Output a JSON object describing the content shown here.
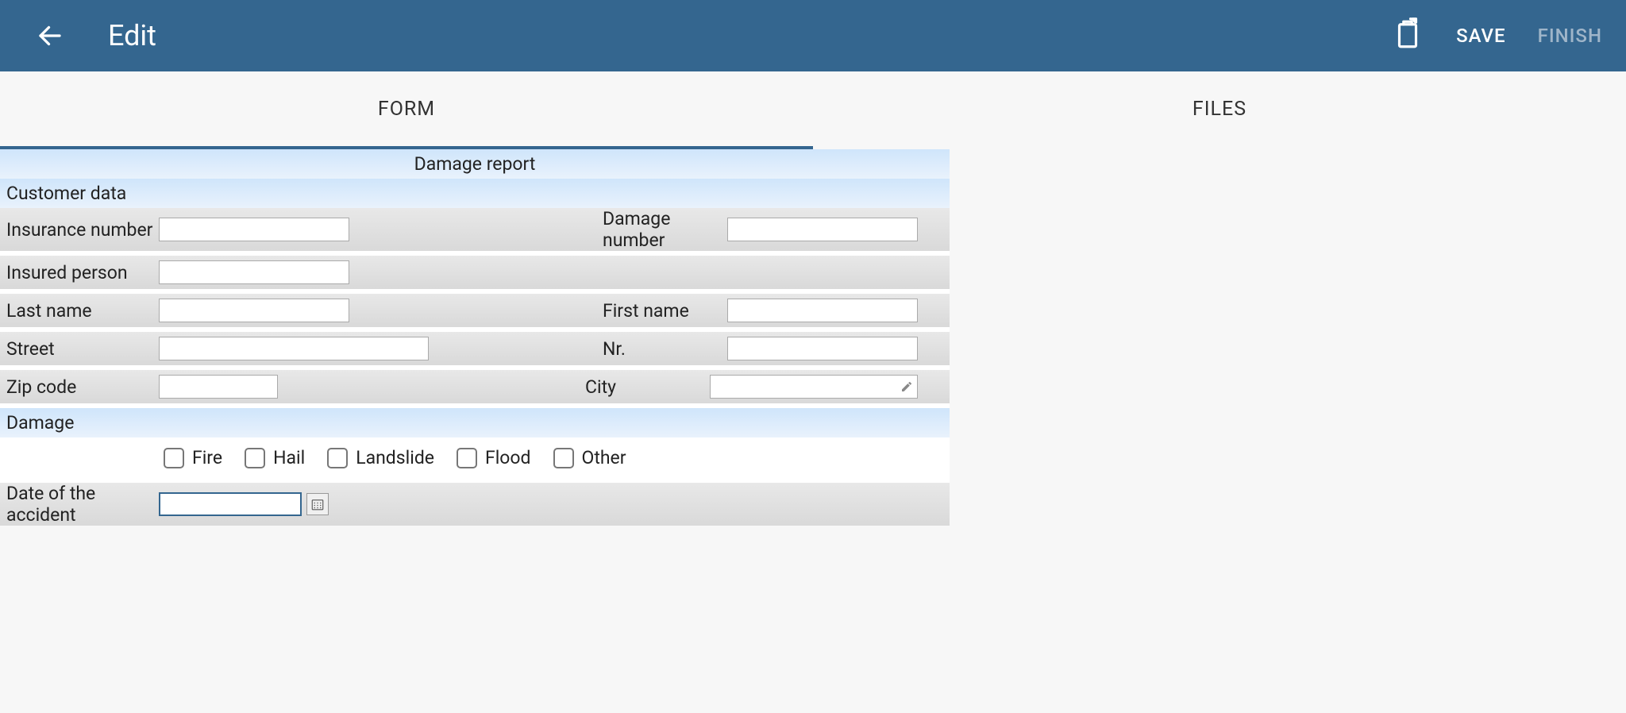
{
  "appBar": {
    "title": "Edit",
    "save": "SAVE",
    "finish": "FINISH"
  },
  "tabs": {
    "form": "FORM",
    "files": "FILES"
  },
  "form": {
    "title": "Damage report",
    "sections": {
      "customer": "Customer data",
      "damage": "Damage"
    },
    "labels": {
      "insuranceNumber": "Insurance number",
      "damageNumber": "Damage number",
      "insuredPerson": "Insured person",
      "lastName": "Last name",
      "firstName": "First name",
      "street": "Street",
      "nr": "Nr.",
      "zipCode": "Zip code",
      "city": "City",
      "dateOfAccident": "Date of the accident"
    },
    "values": {
      "insuranceNumber": "",
      "damageNumber": "",
      "insuredPerson": "",
      "lastName": "",
      "firstName": "",
      "street": "",
      "nr": "",
      "zipCode": "",
      "city": "",
      "dateOfAccident": ""
    },
    "damageTypes": {
      "fire": "Fire",
      "hail": "Hail",
      "landslide": "Landslide",
      "flood": "Flood",
      "other": "Other"
    }
  }
}
